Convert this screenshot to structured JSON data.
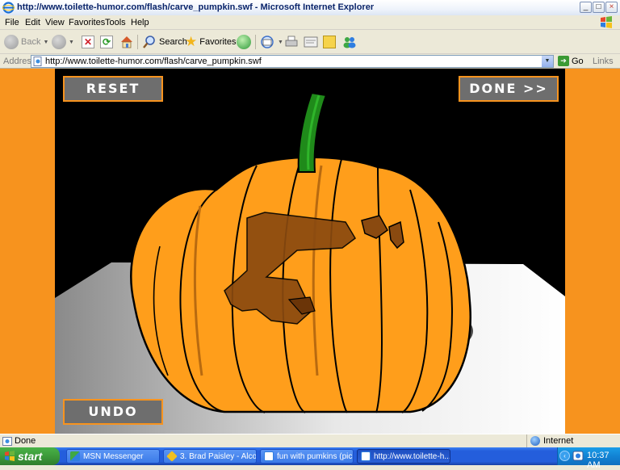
{
  "window": {
    "title": "http://www.toilette-humor.com/flash/carve_pumpkin.swf - Microsoft Internet Explorer",
    "controls": [
      "_",
      "□",
      "×"
    ]
  },
  "menu": [
    "File",
    "Edit",
    "View",
    "Favorites",
    "Tools",
    "Help"
  ],
  "toolbar": {
    "back_label": "Back",
    "search_label": "Search",
    "favorites_label": "Favorites"
  },
  "address": {
    "label": "Address",
    "url": "http://www.toilette-humor.com/flash/carve_pumpkin.swf",
    "go_label": "Go",
    "links_label": "Links"
  },
  "flash": {
    "reset_label": "RESET",
    "done_label": "DONE >>",
    "undo_label": "UNDO"
  },
  "status": {
    "text": "Done",
    "zone": "Internet"
  },
  "taskbar": {
    "start_label": "start",
    "tasks": [
      {
        "label": "MSN Messenger",
        "icon": "msn-icon"
      },
      {
        "label": "3. Brad Paisley - Alco...",
        "icon": "winamp-icon"
      },
      {
        "label": "fun with pumkins (pic...",
        "icon": "ie-page-icon"
      },
      {
        "label": "http://www.toilette-h...",
        "icon": "ie-page-icon"
      }
    ],
    "clock": "10:37 AM"
  },
  "colors": {
    "orange": "#f7931e",
    "pumpkin": "#ff9a14",
    "stem": "#1f8a1a",
    "carved": "#8a4a10"
  }
}
